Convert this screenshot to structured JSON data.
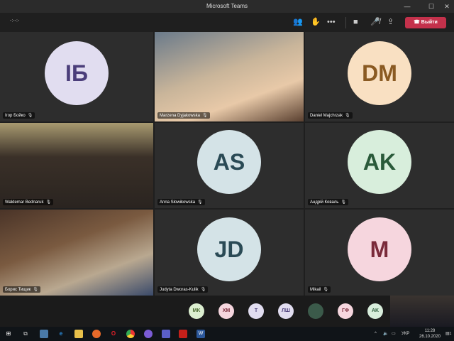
{
  "window": {
    "title": "Microsoft Teams",
    "minimize": "—",
    "maximize": "☐",
    "close": "✕"
  },
  "toolbar": {
    "timer": "-:--:-",
    "leave_label": "Выйти"
  },
  "tiles": [
    {
      "name": "Ігор Бойко",
      "initials": "ІБ",
      "bg": "#e1ddf0",
      "fg": "#4b3e7a",
      "video": false
    },
    {
      "name": "Marzena Dyjakowska",
      "video": true
    },
    {
      "name": "Daniel Majchrzak",
      "initials": "DM",
      "bg": "#f9e0c2",
      "fg": "#8a5a22",
      "video": false
    },
    {
      "name": "Waldemar Bednaruk",
      "video": true
    },
    {
      "name": "Anna Słowikowska",
      "initials": "AS",
      "bg": "#d4e3e7",
      "fg": "#2a4a55",
      "video": false
    },
    {
      "name": "Андрій Коваль",
      "initials": "AK",
      "bg": "#d8eedc",
      "fg": "#2a5a3a",
      "video": false
    },
    {
      "name": "Борис Тищик",
      "video": true
    },
    {
      "name": "Judyta Dworas-Kulik",
      "initials": "JD",
      "bg": "#d4e3e7",
      "fg": "#2a4a55",
      "video": false
    },
    {
      "name": "Mikail",
      "initials": "M",
      "bg": "#f6d6de",
      "fg": "#7a2a3a",
      "video": false
    }
  ],
  "strip": [
    {
      "initials": "MK",
      "bg": "#dcefd0",
      "fg": "#4a6a30"
    },
    {
      "initials": "ХМ",
      "bg": "#f6d6de",
      "fg": "#7a2a3a"
    },
    {
      "initials": "T",
      "bg": "#e1ddf0",
      "fg": "#4b3e7a"
    },
    {
      "initials": "ЛШ",
      "bg": "#e1ddf0",
      "fg": "#4b3e7a"
    },
    {
      "initials": "",
      "bg": "#3b5a4a",
      "fg": "#fff"
    },
    {
      "initials": "ГФ",
      "bg": "#f6d6de",
      "fg": "#7a2a3a"
    },
    {
      "initials": "AK",
      "bg": "#d8eedc",
      "fg": "#2a5a3a"
    }
  ],
  "taskbar": {
    "lang": "УКР",
    "time": "11:28",
    "date": "26.10.2020",
    "notifications": "1"
  }
}
